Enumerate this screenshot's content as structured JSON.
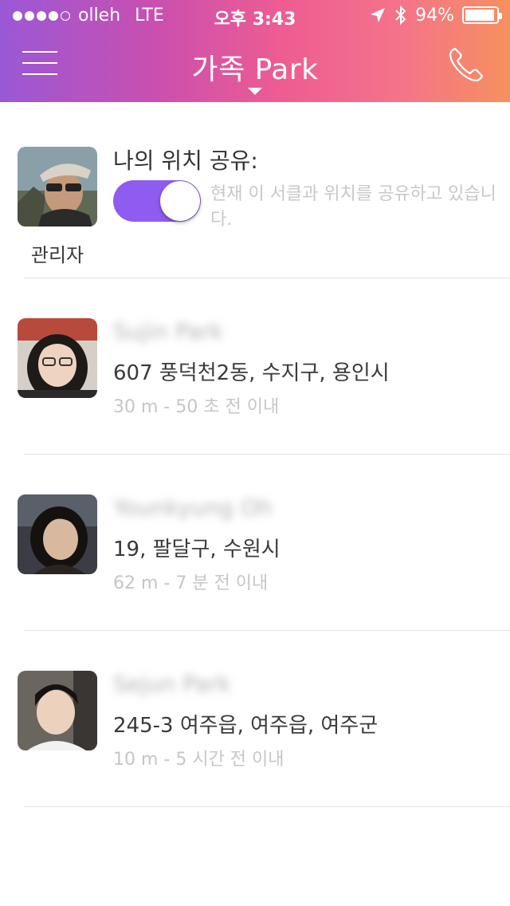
{
  "status_bar": {
    "carrier": "olleh",
    "network": "LTE",
    "time": "오후 3:43",
    "battery": "94%",
    "battery_level": 0.94,
    "signal_bars": 4,
    "signal_total": 5,
    "icons": [
      "location-arrow-icon",
      "bluetooth-icon",
      "battery-icon"
    ]
  },
  "header": {
    "title": "가족 Park",
    "icons": [
      "hamburger-menu-icon",
      "chevron-down-icon",
      "phone-icon"
    ]
  },
  "me": {
    "share_title": "나의 위치 공유:",
    "role": "관리자",
    "share_enabled": true,
    "share_description": "현재 이 서클과 위치를 공유하고 있습니다."
  },
  "members": [
    {
      "name": "Sujin Park",
      "address": "607 풍덕천2동, 수지구, 용인시",
      "meta": "30 m - 50 초 전 이내"
    },
    {
      "name": "Younkyung Oh",
      "address": "19, 팔달구, 수원시",
      "meta": "62 m - 7 분 전 이내"
    },
    {
      "name": "Sejun Park",
      "address": "245-3 여주읍, 여주읍, 여주군",
      "meta": "10 m - 5 시간 전 이내"
    }
  ],
  "colors": {
    "gradient_start": "#9a58d6",
    "gradient_end": "#f6905f",
    "toggle_on": "#8e5cf0",
    "muted_text": "#c6c6c6",
    "divider": "#e3e3e3"
  }
}
